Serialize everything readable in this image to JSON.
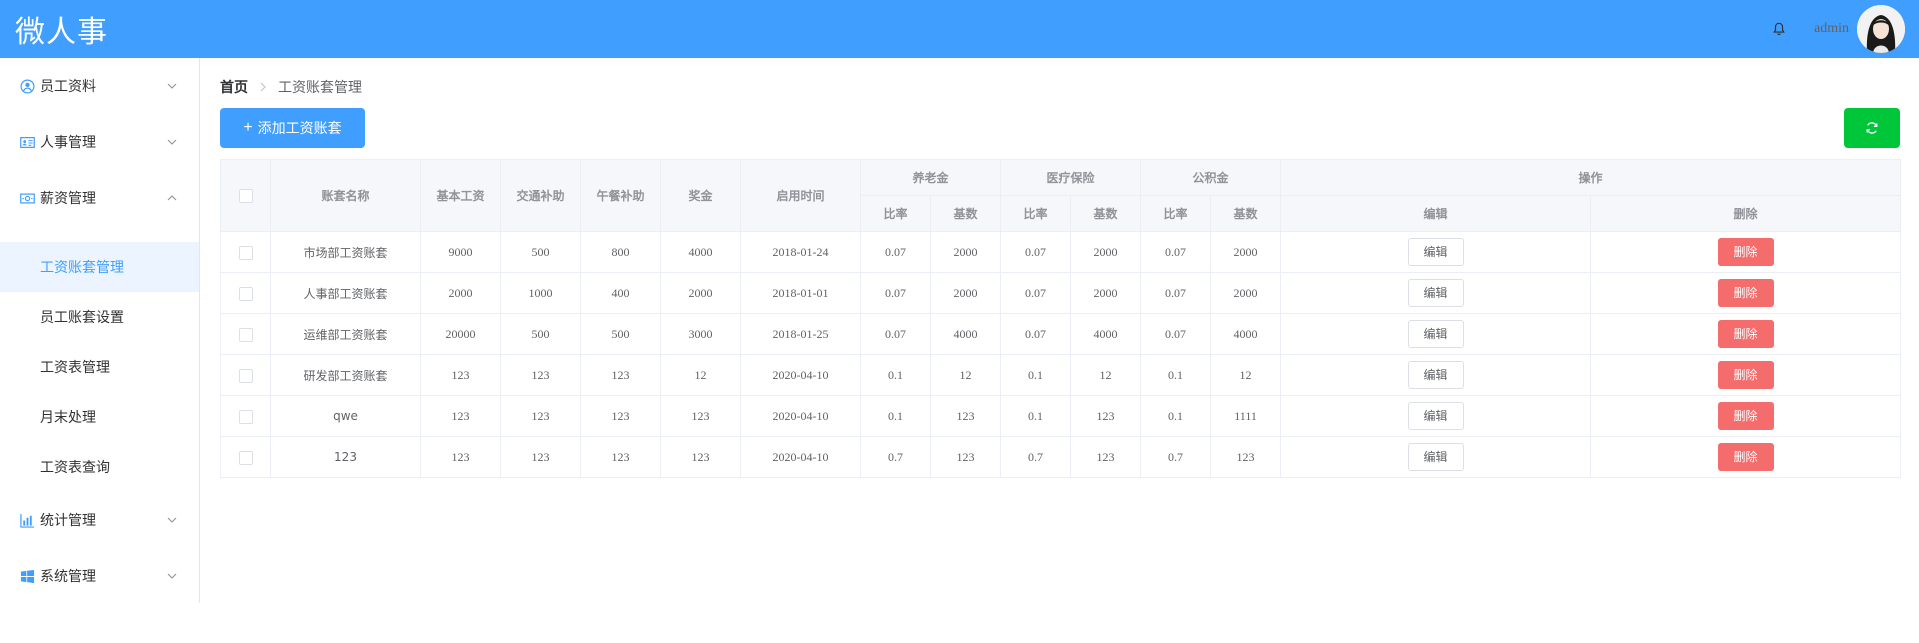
{
  "app": {
    "logo": "微人事",
    "username": "admin"
  },
  "sidebar": {
    "menus": [
      {
        "label": "员工资料",
        "icon": "user-circle-icon"
      },
      {
        "label": "人事管理",
        "icon": "id-card-icon"
      },
      {
        "label": "薪资管理",
        "icon": "money-icon",
        "expanded": true,
        "children": [
          "工资账套管理",
          "员工账套设置",
          "工资表管理",
          "月末处理",
          "工资表查询"
        ],
        "active_child": "工资账套管理"
      },
      {
        "label": "统计管理",
        "icon": "bar-chart-icon"
      },
      {
        "label": "系统管理",
        "icon": "windows-icon"
      }
    ]
  },
  "breadcrumb": {
    "home": "首页",
    "current": "工资账套管理"
  },
  "toolbar": {
    "add_label": "添加工资账套"
  },
  "table": {
    "headers": {
      "name": "账套名称",
      "basic": "基本工资",
      "traffic": "交通补助",
      "lunch": "午餐补助",
      "bonus": "奖金",
      "start": "启用时间",
      "pension": "养老金",
      "medical": "医疗保险",
      "fund": "公积金",
      "ops": "操作",
      "ratio": "比率",
      "base": "基数",
      "edit": "编辑",
      "delete": "删除"
    },
    "edit_label": "编辑",
    "delete_label": "删除",
    "rows": [
      [
        "市场部工资账套",
        "9000",
        "500",
        "800",
        "4000",
        "2018-01-24",
        "0.07",
        "2000",
        "0.07",
        "2000",
        "0.07",
        "2000"
      ],
      [
        "人事部工资账套",
        "2000",
        "1000",
        "400",
        "2000",
        "2018-01-01",
        "0.07",
        "2000",
        "0.07",
        "2000",
        "0.07",
        "2000"
      ],
      [
        "运维部工资账套",
        "20000",
        "500",
        "500",
        "3000",
        "2018-01-25",
        "0.07",
        "4000",
        "0.07",
        "4000",
        "0.07",
        "4000"
      ],
      [
        "研发部工资账套",
        "123",
        "123",
        "123",
        "12",
        "2020-04-10",
        "0.1",
        "12",
        "0.1",
        "12",
        "0.1",
        "12"
      ],
      [
        "qwe",
        "123",
        "123",
        "123",
        "123",
        "2020-04-10",
        "0.1",
        "123",
        "0.1",
        "123",
        "0.1",
        "1111"
      ],
      [
        "123",
        "123",
        "123",
        "123",
        "123",
        "2020-04-10",
        "0.7",
        "123",
        "0.7",
        "123",
        "0.7",
        "123"
      ]
    ]
  },
  "colors": {
    "primary": "#409eff",
    "success": "#00c739",
    "danger": "#f56c6c"
  }
}
